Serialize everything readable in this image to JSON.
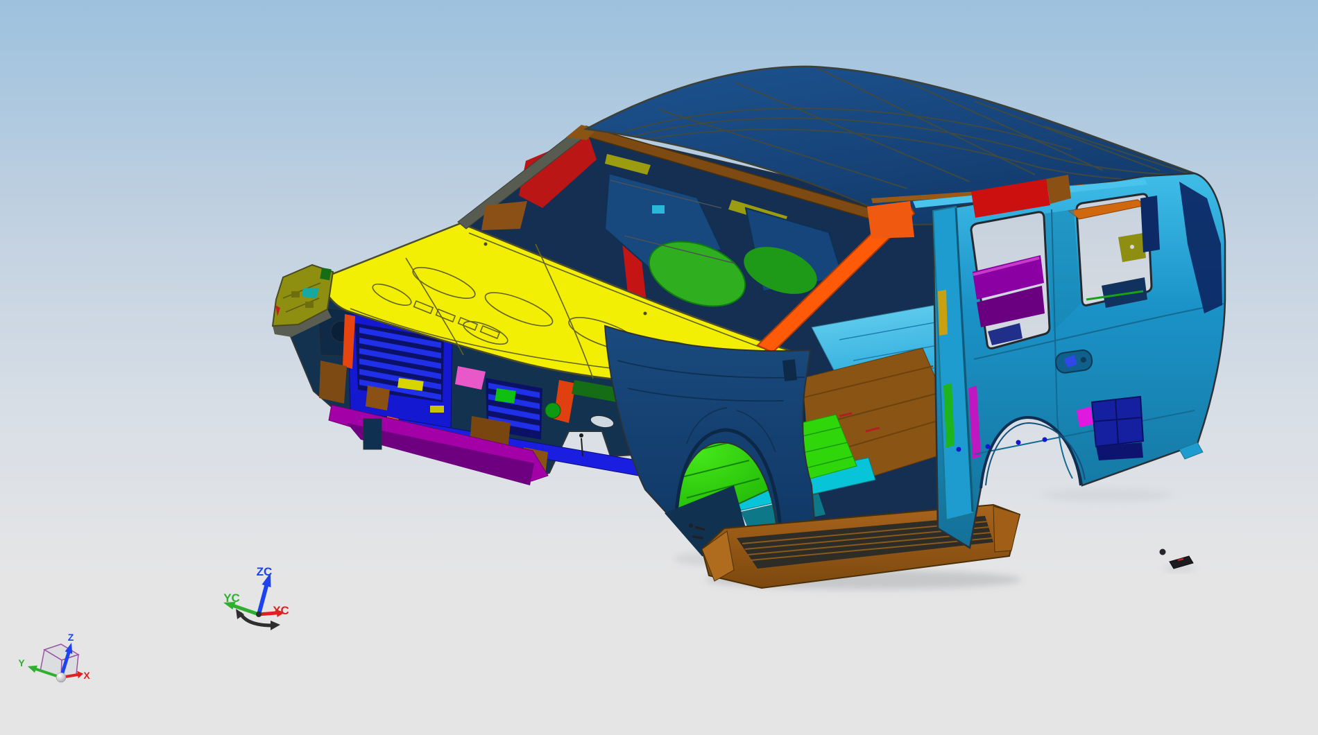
{
  "scene": {
    "wcs_triad": {
      "z_label": "ZC",
      "y_label": "YC",
      "x_label": "XC"
    },
    "view_triad": {
      "z_label": "Z",
      "y_label": "Y",
      "x_label": "X"
    },
    "parts": [
      {
        "name": "hood-panel",
        "color": "#f2ee04"
      },
      {
        "name": "roof-panel",
        "color": "#1d538f"
      },
      {
        "name": "body-side-panel",
        "color": "#1b93c8"
      },
      {
        "name": "front-fender",
        "color": "#15406e"
      },
      {
        "name": "windshield-header",
        "color": "#7c4a12"
      },
      {
        "name": "a-pillar-hinge-pillar",
        "color": "#ff5a08"
      },
      {
        "name": "cowl-panel",
        "color": "#bc08bc"
      },
      {
        "name": "radiator-support",
        "color": "#1418d0"
      },
      {
        "name": "bumper-beam",
        "color": "#a400a8"
      },
      {
        "name": "front-floor-pan",
        "color": "#1ecc04"
      },
      {
        "name": "center-floor-pan",
        "color": "#8a5414"
      },
      {
        "name": "rear-floor-pan",
        "color": "#21a3d8"
      },
      {
        "name": "rocker-step-assembly",
        "color": "#a8641c"
      },
      {
        "name": "b-pillar",
        "color": "#1f9ccf"
      },
      {
        "name": "quarter-trim-panel",
        "color": "#8a00a2"
      },
      {
        "name": "fender-rail-left",
        "color": "#8e8e10"
      },
      {
        "name": "roof-rail-reinforcement",
        "color": "#cc0f0f"
      },
      {
        "name": "wheelhouse-bracket",
        "color": "#1420a0"
      }
    ]
  },
  "colors": {
    "bg_top": "#9dc1de",
    "bg_mid": "#d9dfe6",
    "bg_bottom": "#e5e5e6",
    "edge_dark": "#2c3136",
    "hood_yellow": "#f2ee04",
    "roof_navy_light": "#1d538f",
    "roof_navy_dark": "#123a6c",
    "header_brown": "#7c4a12",
    "body_cyan_light": "#3fbde8",
    "body_cyan": "#1b93c8",
    "body_cyan_dark": "#147199",
    "fender_navy_light": "#1a4a7e",
    "fender_navy_dark": "#0f3764",
    "floor_green": "#1ecc04",
    "floor_cyan_light": "#6fd6f2",
    "floor_cyan": "#21a3d8",
    "tunnel_brown": "#8a5414",
    "copper_light": "#a8641c",
    "copper_dark": "#7c480e",
    "radiator_blue": "#1418d0",
    "grille_navy": "#0c1168",
    "bumper_magenta": "#a400a8",
    "pillar_orange": "#ff5a08",
    "rail_red": "#cc0f0f",
    "cowl_magenta": "#bc08bc",
    "interior_purple": "#8a00a2",
    "interior_green": "#2fae20",
    "aqua_sill": "#08c4d8",
    "olive_fender": "#8e8e10",
    "axis_x": "#e02020",
    "axis_y": "#2fae2f",
    "axis_z": "#1d43ee",
    "cube_edge": "#9a55a2",
    "shadow_gray": "#aeb0b2"
  }
}
